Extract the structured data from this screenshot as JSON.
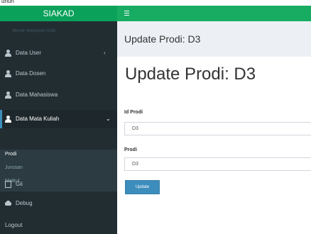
{
  "top_fragment": "unun",
  "app": {
    "brand": "SIAKAD"
  },
  "sidebar": {
    "header": "MAIN NAVIGATION",
    "items": [
      {
        "label": "Data User",
        "icon": "user-icon",
        "chevron": "‹"
      },
      {
        "label": "Data Dosen",
        "icon": "user-icon"
      },
      {
        "label": "Data Mahasiswa",
        "icon": "user-icon"
      },
      {
        "label": "Data Mata Kuliah",
        "icon": "user-icon",
        "chevron": "⌄"
      },
      {
        "label": "Gii",
        "icon": "file-icon"
      },
      {
        "label": "Debug",
        "icon": "dashboard-icon"
      },
      {
        "label": "Logout"
      }
    ],
    "submenu": [
      "Prodi",
      "Jurusan",
      "Matkul"
    ]
  },
  "page": {
    "header_title": "Update Prodi: D3",
    "title": "Update Prodi: D3",
    "fields": [
      {
        "label": "Id Prodi",
        "value": "D3"
      },
      {
        "label": "Prodi",
        "value": "D3"
      }
    ],
    "submit_label": "Update"
  },
  "colors": {
    "brand_green": "#0aa15b",
    "topbar_green": "#18ab62",
    "sidebar_bg": "#222d32",
    "button_blue": "#3c8dbc"
  }
}
